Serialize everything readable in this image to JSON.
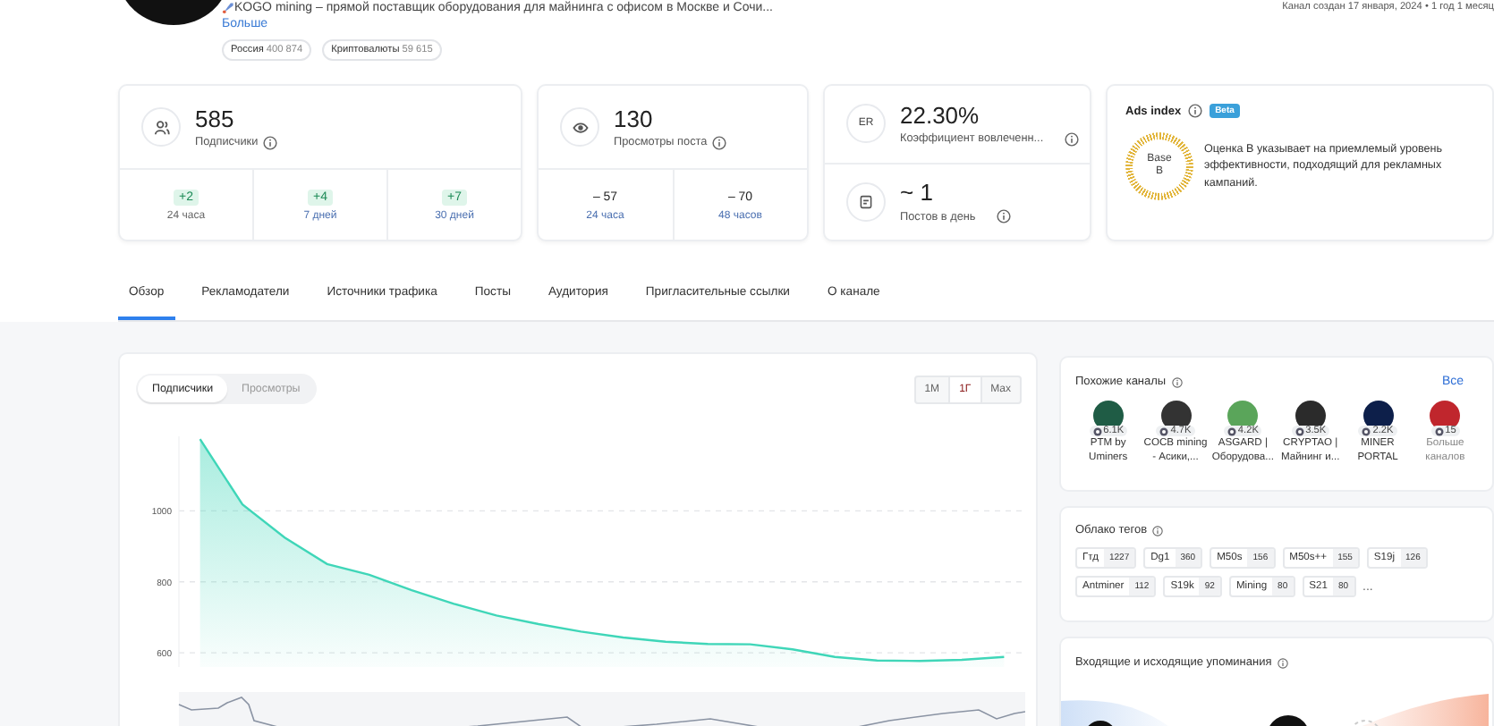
{
  "channel": {
    "description": "KOGO mining – прямой поставщик оборудования для майнинга с офисом в Москве и Сочи...",
    "more_link": "Больше",
    "chips": [
      {
        "label": "Россия",
        "count": "400 874"
      },
      {
        "label": "Криптовалюты",
        "count": "59 615"
      }
    ],
    "created": "Канал создан 17 января, 2024 • 1 год 1 месяц"
  },
  "stats": [
    {
      "kind": "growth",
      "value": "585",
      "label": "Подписчики",
      "periods": [
        {
          "kind": "gain",
          "change": "+2",
          "period": "24 часа",
          "linked": false
        },
        {
          "kind": "gain",
          "change": "+4",
          "period": "7 дней",
          "linked": true
        },
        {
          "kind": "gain",
          "change": "+7",
          "period": "30 дней",
          "linked": true
        }
      ]
    },
    {
      "kind": "growth",
      "value": "130",
      "label": "Просмотры поста",
      "periods": [
        {
          "kind": "plain",
          "change": "– 57",
          "period": "24 часа",
          "linked": true
        },
        {
          "kind": "plain",
          "change": "– 70",
          "period": "48 часов",
          "linked": true
        }
      ]
    },
    {
      "kind": "stack",
      "metrics": [
        {
          "icon_text": "ER",
          "value": "22.30%",
          "label": "Коэффициент вовлеченн..."
        },
        {
          "value": "~ 1",
          "label": "Постов в день"
        }
      ]
    },
    {
      "kind": "ads",
      "title": "Ads index",
      "badge": "Beta",
      "grade_label": "Base",
      "grade": "B",
      "text": "Оценка B указывает на приемлемый уровень эффективности, подходящий для рекламных кампаний."
    }
  ],
  "tabs": [
    {
      "label": "Обзор",
      "selected": true
    },
    {
      "label": "Рекламодатели",
      "selected": false
    },
    {
      "label": "Источники трафика",
      "selected": false
    },
    {
      "label": "Посты",
      "selected": false
    },
    {
      "label": "Аудитория",
      "selected": false
    },
    {
      "label": "Пригласительные ссылки",
      "selected": false
    },
    {
      "label": "О канале",
      "selected": false
    }
  ],
  "chart_card": {
    "toggles": [
      {
        "label": "Подписчики",
        "selected": true
      },
      {
        "label": "Просмотры",
        "selected": false
      }
    ],
    "periods": [
      {
        "label": "1M",
        "selected": false
      },
      {
        "label": "1Г",
        "selected": true
      },
      {
        "label": "Max",
        "selected": false
      }
    ],
    "chart_data": {
      "type": "area",
      "grid": true,
      "categories": [
        null,
        null,
        null,
        null,
        null,
        null,
        null,
        null,
        null,
        null,
        null,
        null,
        null,
        null,
        null,
        null,
        null,
        null,
        null,
        null
      ],
      "ylim": [
        560,
        1210
      ],
      "yticks": [
        600,
        800,
        1000
      ],
      "series": [
        {
          "color": "#3fd6b8",
          "values": [
            1202,
            1018,
            925,
            850,
            820,
            776,
            738,
            705,
            681,
            660,
            643,
            631,
            625,
            624,
            610,
            588,
            578,
            577,
            580,
            588
          ]
        }
      ]
    }
  },
  "similar": {
    "title": "Похожие каналы",
    "all_link": "Все",
    "channels": [
      {
        "kind": "channel",
        "name_lines": [
          "PTM by",
          "Uminers"
        ],
        "count": "6.1K",
        "color": "#1f5c45"
      },
      {
        "kind": "channel",
        "name_lines": [
          "COCB mining",
          "- Асики,..."
        ],
        "count": "4.7K",
        "color": "#333333"
      },
      {
        "kind": "channel",
        "name_lines": [
          "ASGARD |",
          "Оборудова..."
        ],
        "count": "4.2K",
        "color": "#5aa55a"
      },
      {
        "kind": "channel",
        "name_lines": [
          "CRYPTAO |",
          "Майнинг и..."
        ],
        "count": "3.5K",
        "color": "#2b2b2b"
      },
      {
        "kind": "channel",
        "name_lines": [
          "MINER",
          "PORTAL"
        ],
        "count": "2.2K",
        "color": "#0d1f4a"
      },
      {
        "kind": "more",
        "name_lines": [
          "Больше",
          "каналов"
        ],
        "count": "15",
        "color": "#c0262d"
      }
    ]
  },
  "tags": {
    "title": "Облако тегов",
    "items": [
      {
        "label": "Гтд",
        "count": "1227"
      },
      {
        "label": "Dg1",
        "count": "360"
      },
      {
        "label": "M50s",
        "count": "156"
      },
      {
        "label": "M50s++",
        "count": "155"
      },
      {
        "label": "S19j",
        "count": "126"
      },
      {
        "label": "Antminer",
        "count": "112"
      },
      {
        "label": "S19k",
        "count": "92"
      },
      {
        "label": "Mining",
        "count": "80"
      },
      {
        "label": "S21",
        "count": "80"
      }
    ],
    "more": "..."
  },
  "mentions": {
    "title": "Входящие и исходящие упоминания"
  }
}
